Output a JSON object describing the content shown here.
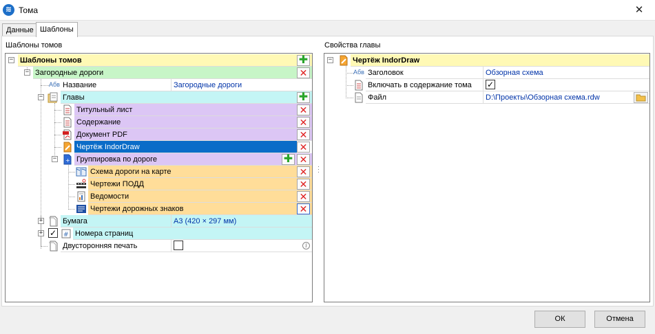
{
  "window": {
    "title": "Тома",
    "close_glyph": "✕"
  },
  "tabs": [
    {
      "label": "Данные",
      "active": false
    },
    {
      "label": "Шаблоны",
      "active": true
    }
  ],
  "left_panel": {
    "label": "Шаблоны томов",
    "root": "Шаблоны томов",
    "template": "Загородные дороги",
    "name_prop": {
      "label": "Название",
      "value": "Загородные дороги"
    },
    "chapters_label": "Главы",
    "chapters": [
      {
        "label": "Титульный лист",
        "icon": "document-icon"
      },
      {
        "label": "Содержание",
        "icon": "document-icon"
      },
      {
        "label": "Документ PDF",
        "icon": "pdf-icon"
      },
      {
        "label": "Чертёж IndorDraw",
        "icon": "drawing-icon",
        "selected": true
      },
      {
        "label": "Группировка по дороге",
        "icon": "grouping-icon"
      }
    ],
    "grouping_children": [
      {
        "label": "Схема дороги на карте",
        "icon": "map-icon"
      },
      {
        "label": "Чертежи ПОДД",
        "icon": "road-markings-icon"
      },
      {
        "label": "Ведомости",
        "icon": "statement-icon"
      },
      {
        "label": "Чертежи дорожных знаков",
        "icon": "road-signs-icon"
      }
    ],
    "paper": {
      "label": "Бумага",
      "value": "А3 (420 × 297 мм)"
    },
    "page_numbers": {
      "label": "Номера страниц",
      "checked": true
    },
    "duplex": {
      "label": "Двусторонняя печать",
      "checked": false
    }
  },
  "right_panel": {
    "label": "Свойства главы",
    "header": "Чертёж IndorDraw",
    "properties": [
      {
        "label": "Заголовок",
        "value": "Обзорная схема"
      },
      {
        "label": "Включать в содержание тома",
        "checked": true
      },
      {
        "label": "Файл",
        "value": "D:\\Проекты\\Обзорная схема.rdw"
      }
    ]
  },
  "footer": {
    "ok": "ОК",
    "cancel": "Отмена"
  },
  "glyphs": {
    "plus": "+",
    "minus": "−",
    "add": "✚",
    "delete": "✕",
    "check": "✓",
    "abc": "Абв",
    "info": "i"
  },
  "colors": {
    "selection": "#0a6cc8",
    "value_text": "#0033a8",
    "add": "#2aa52a",
    "delete": "#e02020"
  }
}
